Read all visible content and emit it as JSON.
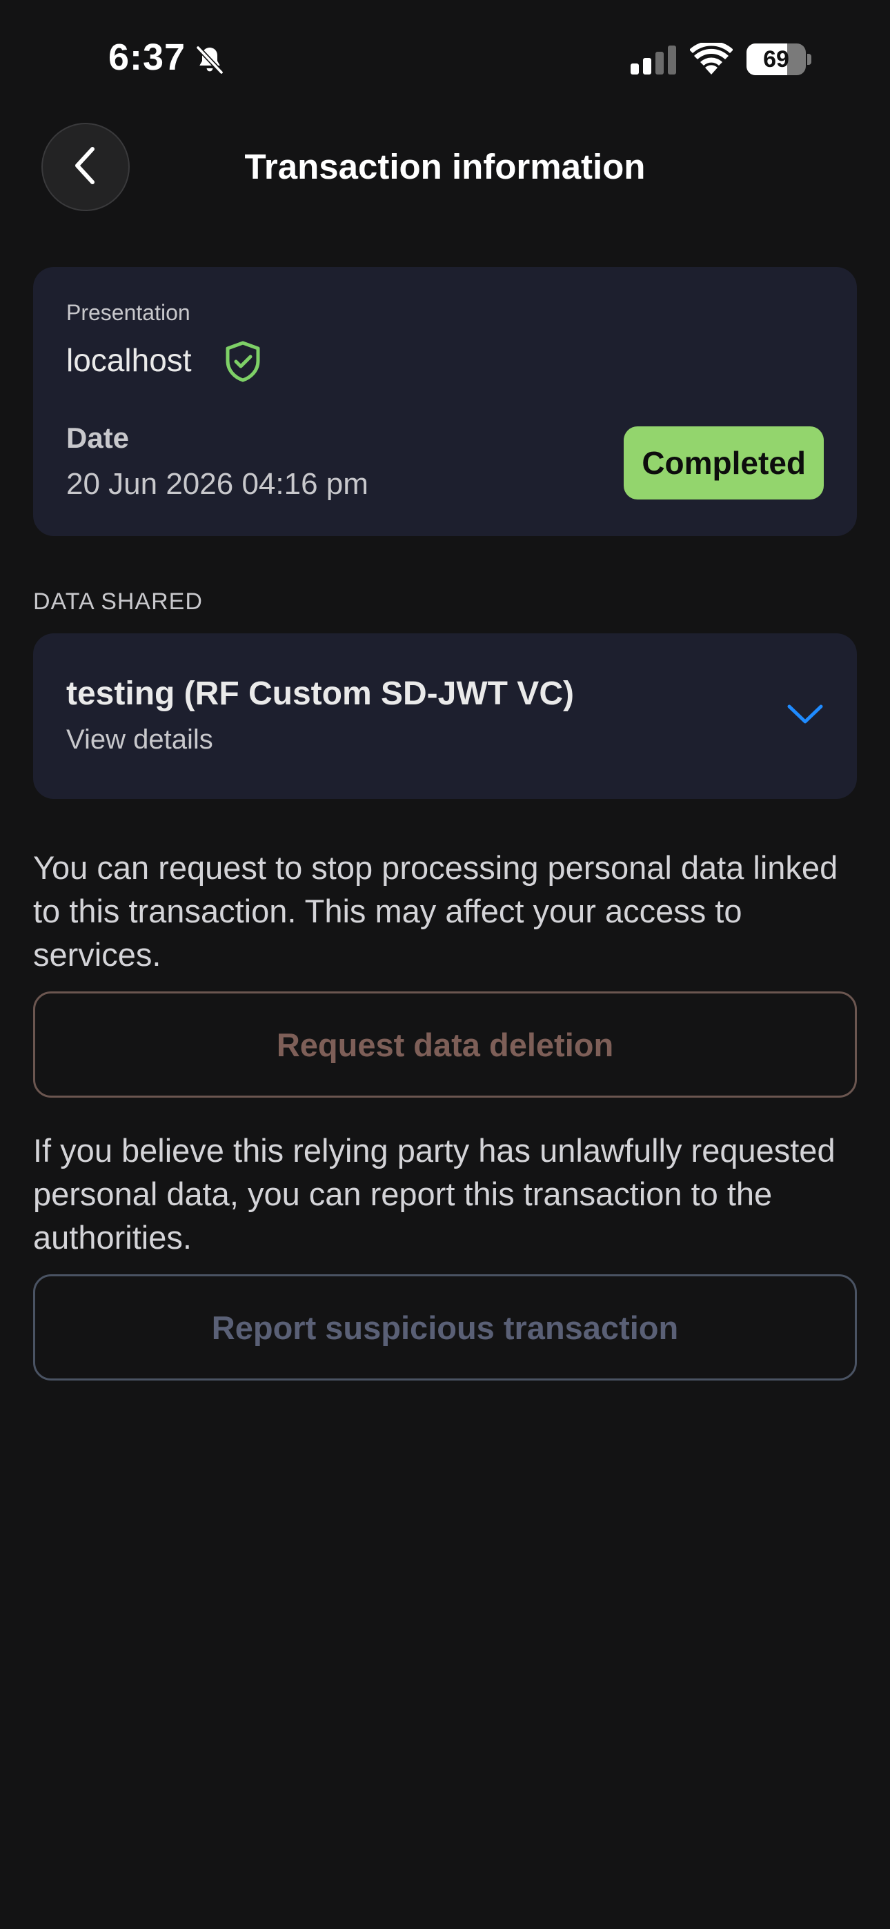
{
  "status_bar": {
    "time": "6:37",
    "battery_level": "69",
    "battery_fraction": 0.69,
    "icons": [
      "bell-slash-icon",
      "cellular-signal-icon",
      "wifi-icon",
      "battery-icon"
    ]
  },
  "header": {
    "title": "Transaction information",
    "back_icon": "chevron-left-icon"
  },
  "transaction": {
    "type_label": "Presentation",
    "relying_party": "localhost",
    "verified_icon": "shield-check-icon",
    "date_label": "Date",
    "date_value": "20 Jun 2026 04:16 pm",
    "status": "Completed",
    "status_color": "#93d56d"
  },
  "data_shared": {
    "section_label": "DATA SHARED",
    "credential_name": "testing (RF Custom SD-JWT VC)",
    "details_label": "View details",
    "expand_icon": "chevron-down-icon",
    "accent_color": "#1f8bff"
  },
  "deletion": {
    "text": "You can request to stop processing personal data linked to this transaction. This may affect your access to services.",
    "button_label": "Request data deletion"
  },
  "report": {
    "text": "If you believe this relying party has unlawfully requested personal data, you can report this transaction to the authorities.",
    "button_label": "Report suspicious transaction"
  },
  "colors": {
    "background": "#131314",
    "card": "#1d1f2e"
  }
}
